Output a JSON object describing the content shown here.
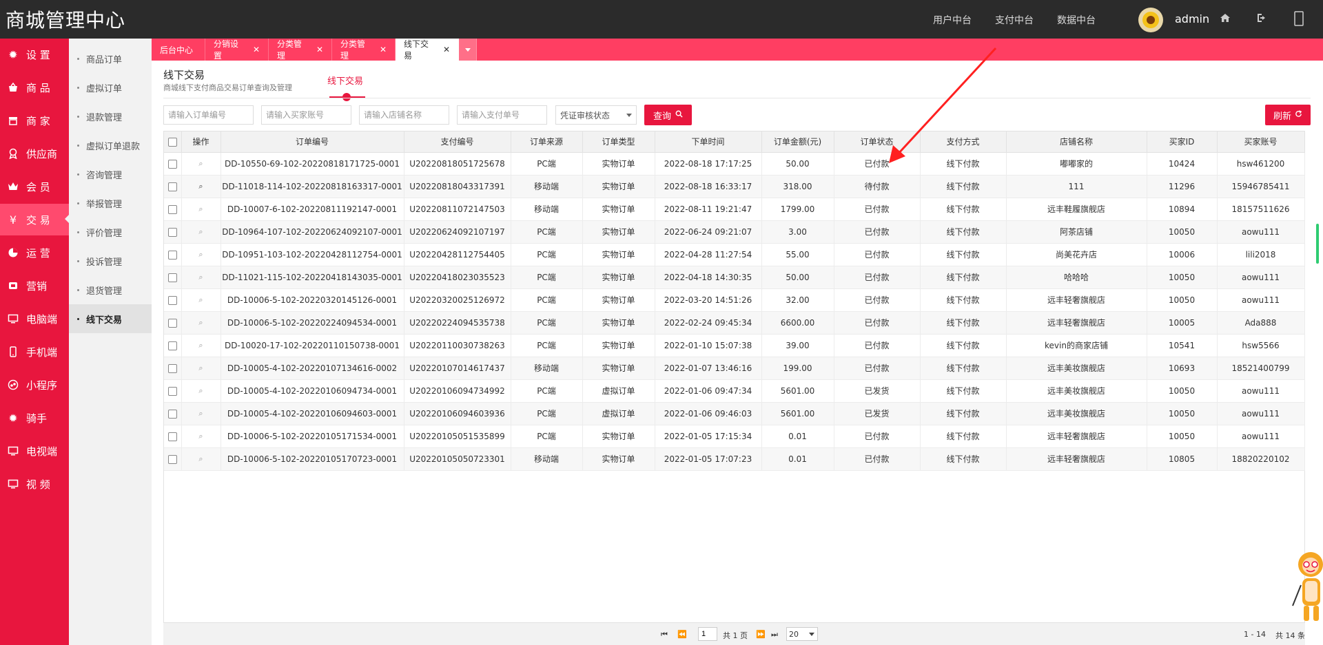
{
  "header": {
    "logo": "商城管理中心",
    "nav": [
      "用户中台",
      "支付中台",
      "数据中台"
    ],
    "username": "admin"
  },
  "sidebar": {
    "items": [
      {
        "label": "设 置",
        "icon": "gear-icon"
      },
      {
        "label": "商 品",
        "icon": "basket-icon"
      },
      {
        "label": "商 家",
        "icon": "store-icon"
      },
      {
        "label": "供应商",
        "icon": "badge-icon"
      },
      {
        "label": "会 员",
        "icon": "crown-icon"
      },
      {
        "label": "交 易",
        "icon": "yen-icon"
      },
      {
        "label": "运 营",
        "icon": "pie-icon"
      },
      {
        "label": "营销",
        "icon": "megaphone-icon"
      },
      {
        "label": "电脑端",
        "icon": "monitor-icon"
      },
      {
        "label": "手机端",
        "icon": "phone-icon"
      },
      {
        "label": "小程序",
        "icon": "miniapp-icon"
      },
      {
        "label": "骑手",
        "icon": "gear-icon"
      },
      {
        "label": "电视端",
        "icon": "tv-icon"
      },
      {
        "label": "视 频",
        "icon": "video-icon"
      }
    ]
  },
  "submenu": {
    "items": [
      "商品订单",
      "虚拟订单",
      "退款管理",
      "虚拟订单退款",
      "咨询管理",
      "举报管理",
      "评价管理",
      "投诉管理",
      "退货管理",
      "线下交易"
    ]
  },
  "tabs": [
    {
      "label": "后台中心",
      "closable": false
    },
    {
      "label": "分销设置",
      "closable": true
    },
    {
      "label": "分类管理",
      "closable": true
    },
    {
      "label": "分类管理",
      "closable": true
    },
    {
      "label": "线下交易",
      "closable": true
    }
  ],
  "page": {
    "title": "线下交易",
    "subtitle": "商城线下支付商品交易订单查询及管理",
    "tab": "线下交易"
  },
  "filters": {
    "order_no": "请输入订单编号",
    "buyer": "请输入买家账号",
    "store": "请输入店铺名称",
    "pay_no": "请输入支付单号",
    "status_select": "凭证审核状态",
    "search_label": "查询",
    "refresh_label": "刷新"
  },
  "table": {
    "columns": [
      "操作",
      "订单编号",
      "支付编号",
      "订单来源",
      "订单类型",
      "下单时间",
      "订单金额(元)",
      "订单状态",
      "支付方式",
      "店铺名称",
      "买家ID",
      "买家账号"
    ],
    "rows": [
      [
        "DD-10550-69-102-20220818171725-0001",
        "U20220818051725678",
        "PC端",
        "实物订单",
        "2022-08-18 17:17:25",
        "50.00",
        "已付款",
        "线下付款",
        "嘟嘟家的",
        "10424",
        "hsw461200"
      ],
      [
        "DD-11018-114-102-20220818163317-0001",
        "U20220818043317391",
        "移动端",
        "实物订单",
        "2022-08-18 16:33:17",
        "318.00",
        "待付款",
        "线下付款",
        "111",
        "11296",
        "15946785411"
      ],
      [
        "DD-10007-6-102-20220811192147-0001",
        "U20220811072147503",
        "移动端",
        "实物订单",
        "2022-08-11 19:21:47",
        "1799.00",
        "已付款",
        "线下付款",
        "远丰鞋履旗舰店",
        "10894",
        "18157511626"
      ],
      [
        "DD-10964-107-102-20220624092107-0001",
        "U20220624092107197",
        "PC端",
        "实物订单",
        "2022-06-24 09:21:07",
        "3.00",
        "已付款",
        "线下付款",
        "阿茶店铺",
        "10050",
        "aowu111"
      ],
      [
        "DD-10951-103-102-20220428112754-0001",
        "U20220428112754405",
        "PC端",
        "实物订单",
        "2022-04-28 11:27:54",
        "55.00",
        "已付款",
        "线下付款",
        "尚美花卉店",
        "10006",
        "lili2018"
      ],
      [
        "DD-11021-115-102-20220418143035-0001",
        "U20220418023035523",
        "PC端",
        "实物订单",
        "2022-04-18 14:30:35",
        "50.00",
        "已付款",
        "线下付款",
        "哈哈哈",
        "10050",
        "aowu111"
      ],
      [
        "DD-10006-5-102-20220320145126-0001",
        "U20220320025126972",
        "PC端",
        "实物订单",
        "2022-03-20 14:51:26",
        "32.00",
        "已付款",
        "线下付款",
        "远丰轻奢旗舰店",
        "10050",
        "aowu111"
      ],
      [
        "DD-10006-5-102-20220224094534-0001",
        "U20220224094535738",
        "PC端",
        "实物订单",
        "2022-02-24 09:45:34",
        "6600.00",
        "已付款",
        "线下付款",
        "远丰轻奢旗舰店",
        "10005",
        "Ada888"
      ],
      [
        "DD-10020-17-102-20220110150738-0001",
        "U20220110030738263",
        "PC端",
        "实物订单",
        "2022-01-10 15:07:38",
        "39.00",
        "已付款",
        "线下付款",
        "kevin的商家店铺",
        "10541",
        "hsw5566"
      ],
      [
        "DD-10005-4-102-20220107134616-0002",
        "U20220107014617437",
        "移动端",
        "实物订单",
        "2022-01-07 13:46:16",
        "199.00",
        "已付款",
        "线下付款",
        "远丰美妆旗舰店",
        "10693",
        "18521400799"
      ],
      [
        "DD-10005-4-102-20220106094734-0001",
        "U20220106094734992",
        "PC端",
        "虚拟订单",
        "2022-01-06 09:47:34",
        "5601.00",
        "已发货",
        "线下付款",
        "远丰美妆旗舰店",
        "10050",
        "aowu111"
      ],
      [
        "DD-10005-4-102-20220106094603-0001",
        "U20220106094603936",
        "PC端",
        "虚拟订单",
        "2022-01-06 09:46:03",
        "5601.00",
        "已发货",
        "线下付款",
        "远丰美妆旗舰店",
        "10050",
        "aowu111"
      ],
      [
        "DD-10006-5-102-20220105171534-0001",
        "U20220105051535899",
        "PC端",
        "实物订单",
        "2022-01-05 17:15:34",
        "0.01",
        "已付款",
        "线下付款",
        "远丰轻奢旗舰店",
        "10050",
        "aowu111"
      ],
      [
        "DD-10006-5-102-20220105170723-0001",
        "U20220105050723301",
        "移动端",
        "实物订单",
        "2022-01-05 17:07:23",
        "0.01",
        "已付款",
        "线下付款",
        "远丰轻奢旗舰店",
        "10805",
        "18820220102"
      ]
    ]
  },
  "pager": {
    "page_input": "1",
    "total_pages": "共 1 页",
    "page_size": "20",
    "range": "1 - 14",
    "total": "共 14 条"
  },
  "colors": {
    "brand_red": "#e8163e",
    "tab_bar": "#ff3e62",
    "header_bg": "#2b2b2b",
    "annotation_arrow": "#ff2020"
  }
}
